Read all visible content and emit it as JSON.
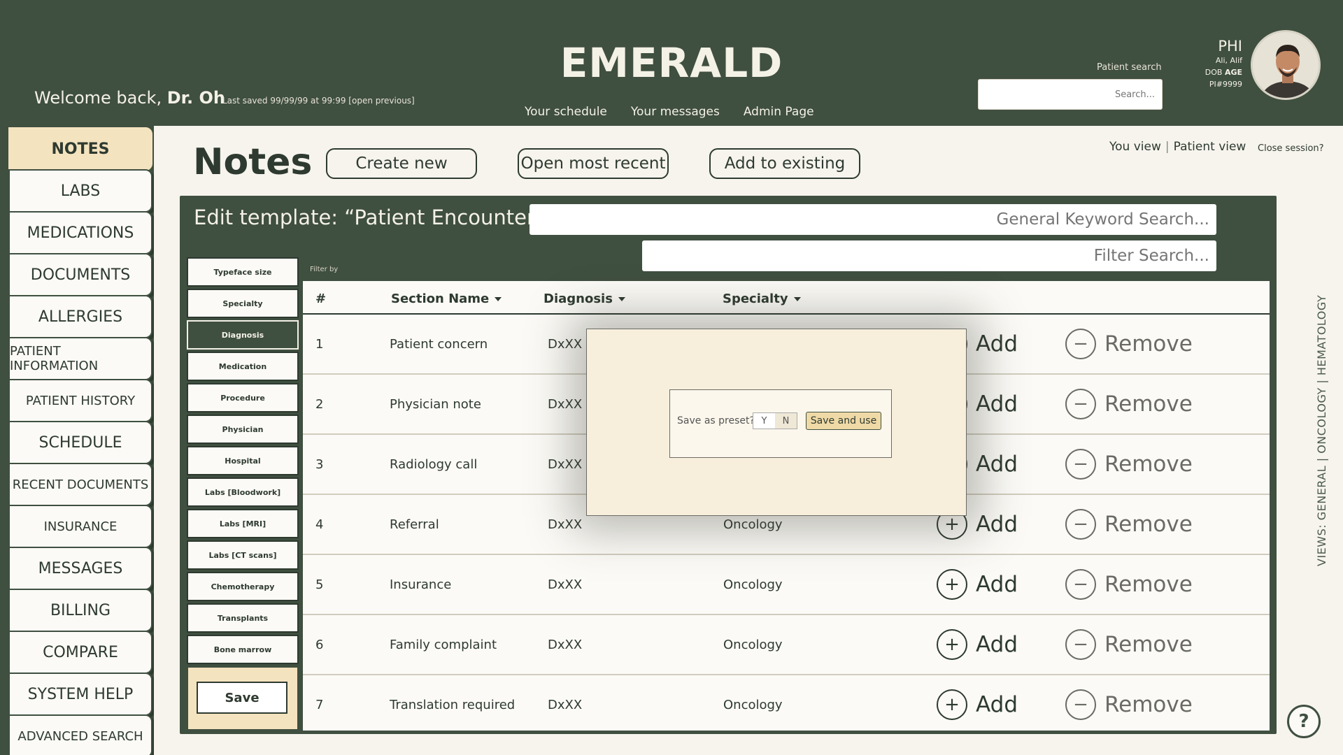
{
  "header": {
    "brand": "EMERALD",
    "welcome_prefix": "Welcome back, ",
    "welcome_name": "Dr. Oh",
    "last_saved": "Last saved 99/99/99 at 99:99  [open previous]",
    "nav": [
      "Your schedule",
      "Your messages",
      "Admin Page"
    ],
    "patient_search_label": "Patient search",
    "patient_search_placeholder": "Search...",
    "phi_title": "PHI",
    "phi_name": "Ali, Alif",
    "phi_dob_prefix": "DOB ",
    "phi_dob_value": "AGE",
    "phi_id": "PI#9999"
  },
  "sidebar": {
    "items": [
      {
        "label": "NOTES",
        "active": true
      },
      {
        "label": "LABS"
      },
      {
        "label": "MEDICATIONS"
      },
      {
        "label": "DOCUMENTS"
      },
      {
        "label": "ALLERGIES"
      },
      {
        "label": "PATIENT INFORMATION",
        "small": true
      },
      {
        "label": "PATIENT HISTORY",
        "small": true
      },
      {
        "label": "SCHEDULE"
      },
      {
        "label": "RECENT DOCUMENTS",
        "small": true
      },
      {
        "label": "INSURANCE",
        "small": true
      },
      {
        "label": "MESSAGES"
      },
      {
        "label": "BILLING"
      },
      {
        "label": "COMPARE"
      },
      {
        "label": "SYSTEM HELP"
      },
      {
        "label": "ADVANCED SEARCH",
        "small": true
      }
    ]
  },
  "main": {
    "title": "Notes",
    "buttons": {
      "create_new": "Create new",
      "open_recent": "Open most recent",
      "add_existing": "Add to existing"
    },
    "view_you": "You view",
    "view_sep": "|",
    "view_patient": "Patient view",
    "close_session": "Close session?"
  },
  "panel": {
    "edit_title": "Edit template: “Patient Encounter”",
    "keyword_placeholder": "General Keyword Search...",
    "filter_placeholder": "Filter Search...",
    "filter_by": "Filter by",
    "filters": [
      {
        "label": "Typeface size"
      },
      {
        "label": "Specialty"
      },
      {
        "label": "Diagnosis",
        "active": true
      },
      {
        "label": "Medication"
      },
      {
        "label": "Procedure"
      },
      {
        "label": "Physician"
      },
      {
        "label": "Hospital"
      },
      {
        "label": "Labs [Bloodwork]"
      },
      {
        "label": "Labs [MRI]"
      },
      {
        "label": "Labs [CT scans]"
      },
      {
        "label": "Chemotherapy"
      },
      {
        "label": "Transplants"
      },
      {
        "label": "Bone marrow"
      }
    ],
    "save_label": "Save",
    "columns": {
      "num": "#",
      "section": "Section Name",
      "diagnosis": "Diagnosis",
      "specialty": "Specialty"
    },
    "add_label": "Add",
    "remove_label": "Remove",
    "rows": [
      {
        "num": "1",
        "section": "Patient concern",
        "diagnosis": "DxXX",
        "specialty": ""
      },
      {
        "num": "2",
        "section": "Physician note",
        "diagnosis": "DxXX",
        "specialty": ""
      },
      {
        "num": "3",
        "section": "Radiology call",
        "diagnosis": "DxXX",
        "specialty": ""
      },
      {
        "num": "4",
        "section": "Referral",
        "diagnosis": "DxXX",
        "specialty": "Oncology"
      },
      {
        "num": "5",
        "section": "Insurance",
        "diagnosis": "DxXX",
        "specialty": "Oncology"
      },
      {
        "num": "6",
        "section": "Family complaint",
        "diagnosis": "DxXX",
        "specialty": "Oncology"
      },
      {
        "num": "7",
        "section": "Translation required",
        "diagnosis": "DxXX",
        "specialty": "Oncology"
      }
    ]
  },
  "modal": {
    "prompt": "Save as preset?",
    "yes": "Y",
    "no": "N",
    "save_and_use": "Save and use"
  },
  "views_label": "VIEWS: GENERAL | ONCOLOGY | HEMATOLOGY",
  "help_glyph": "?",
  "icons": {
    "add": "plus-circle-icon",
    "remove": "minus-circle-icon",
    "caret": "caret-down-icon",
    "help": "help-icon"
  },
  "colors": {
    "primary": "#3f4f40",
    "accent": "#f4e3bf",
    "background": "#f6f4ed"
  }
}
